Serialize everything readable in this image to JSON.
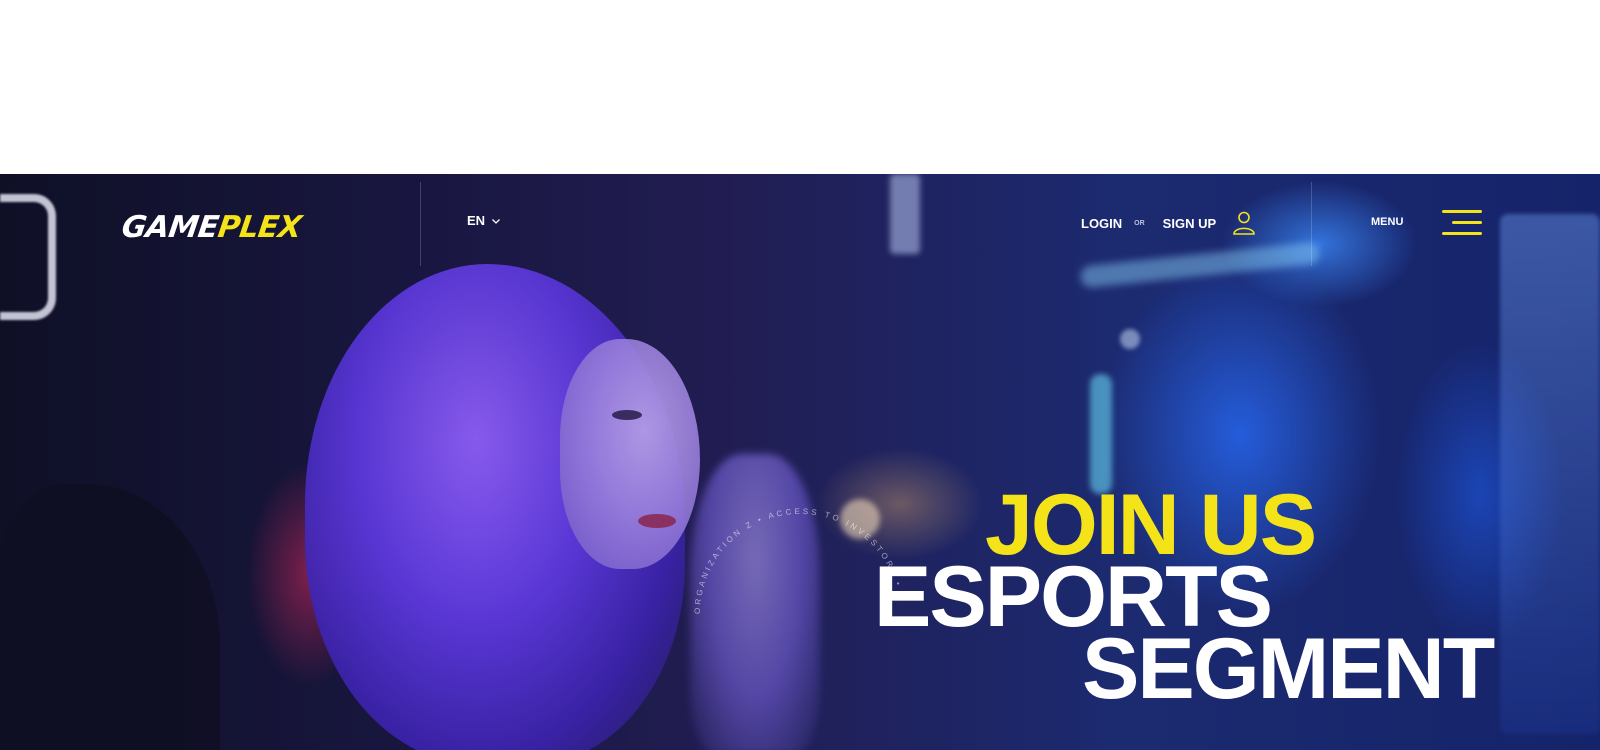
{
  "brand": {
    "logo_white": "GAME",
    "logo_yellow": "PLEX",
    "accent_color": "#f5e31a"
  },
  "header": {
    "language": "EN",
    "login_label": "LOGIN",
    "or_label": "OR",
    "signup_label": "SIGN UP",
    "menu_label": "MENU",
    "icons": {
      "language": "chevron-down-icon",
      "account": "user-icon",
      "menu": "hamburger-menu-icon"
    }
  },
  "hero": {
    "headline": {
      "line1": "JOIN US",
      "line2": "ESPORTS",
      "line3": "SEGMENT"
    },
    "circular_text": "ORGANIZATION Z • ACCESS TO INVESTORS •"
  }
}
